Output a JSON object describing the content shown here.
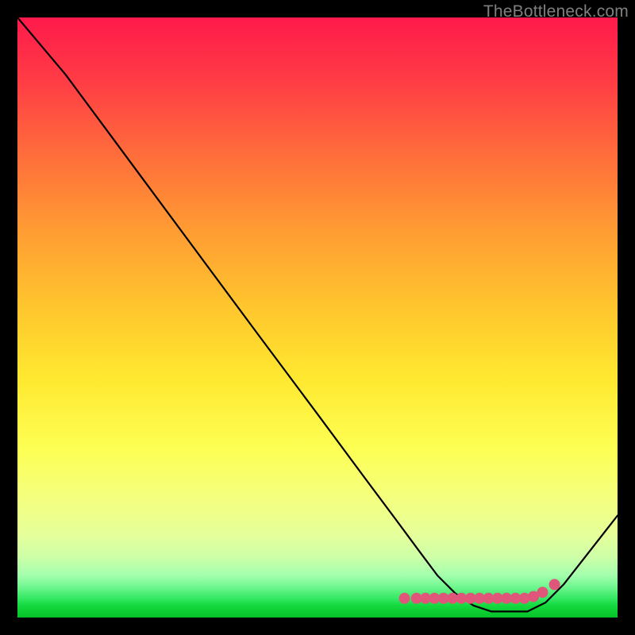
{
  "watermark": "TheBottleneck.com",
  "chart_data": {
    "type": "line",
    "title": "",
    "xlabel": "",
    "ylabel": "",
    "xlim": [
      0,
      100
    ],
    "ylim": [
      0,
      100
    ],
    "grid": false,
    "legend": false,
    "background_gradient": [
      "#ff1a4b",
      "#ffef33",
      "#f6ff7a",
      "#d2ff9e",
      "#06d22b"
    ],
    "series": [
      {
        "name": "curve",
        "color": "#000000",
        "x": [
          0,
          8,
          20,
          30,
          40,
          50,
          58,
          63,
          67,
          70,
          73,
          76,
          79,
          82,
          85,
          88,
          91,
          100
        ],
        "y": [
          100,
          90.5,
          74.3,
          60.8,
          47.3,
          33.9,
          23.1,
          16.4,
          11.0,
          7.0,
          4.0,
          2.0,
          1.0,
          1.0,
          1.0,
          2.5,
          5.5,
          17.0
        ]
      }
    ],
    "markers": {
      "name": "optimal-band",
      "color": "#e0567a",
      "radius_px": 7,
      "x": [
        64.5,
        66.5,
        68.0,
        69.5,
        71.0,
        72.5,
        74.0,
        75.5,
        77.0,
        78.5,
        80.0,
        81.5,
        83.0,
        84.5,
        86.0,
        87.5,
        89.5
      ],
      "y": [
        3.2,
        3.2,
        3.2,
        3.2,
        3.2,
        3.2,
        3.2,
        3.2,
        3.2,
        3.2,
        3.2,
        3.2,
        3.2,
        3.2,
        3.5,
        4.2,
        5.5
      ]
    }
  }
}
